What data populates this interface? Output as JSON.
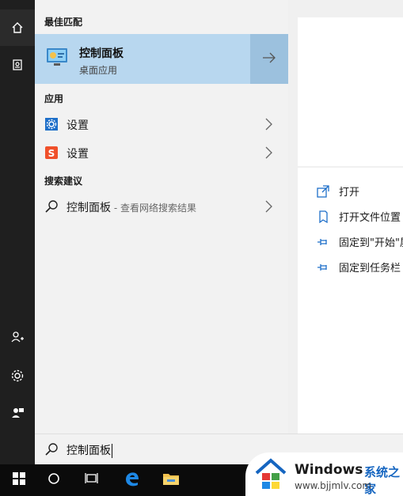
{
  "results": {
    "best_match_header": "最佳匹配",
    "best_match": {
      "title": "控制面板",
      "subtitle": "桌面应用"
    },
    "apps_header": "应用",
    "apps": [
      {
        "label": "设置"
      },
      {
        "label": "设置"
      }
    ],
    "suggest_header": "搜索建议",
    "suggestion": {
      "label": "控制面板",
      "hint": " - 查看网络搜索结果"
    }
  },
  "preview": {
    "actions": [
      {
        "label": "打开",
        "icon": "open-icon"
      },
      {
        "label": "打开文件位置",
        "icon": "file-location-icon"
      },
      {
        "label": "固定到\"开始\"屏",
        "icon": "pin-icon"
      },
      {
        "label": "固定到任务栏",
        "icon": "pin-icon"
      }
    ]
  },
  "search": {
    "value": "控制面板"
  },
  "watermark": {
    "brand": "Windows",
    "cn": "系统之家",
    "url": "www.bjjmlv.com"
  },
  "colors": {
    "highlight": "#b8d7ef",
    "arrow_bg": "#9cc1de",
    "taskbar": "#0b0b0b",
    "accent": "#1565c0"
  }
}
